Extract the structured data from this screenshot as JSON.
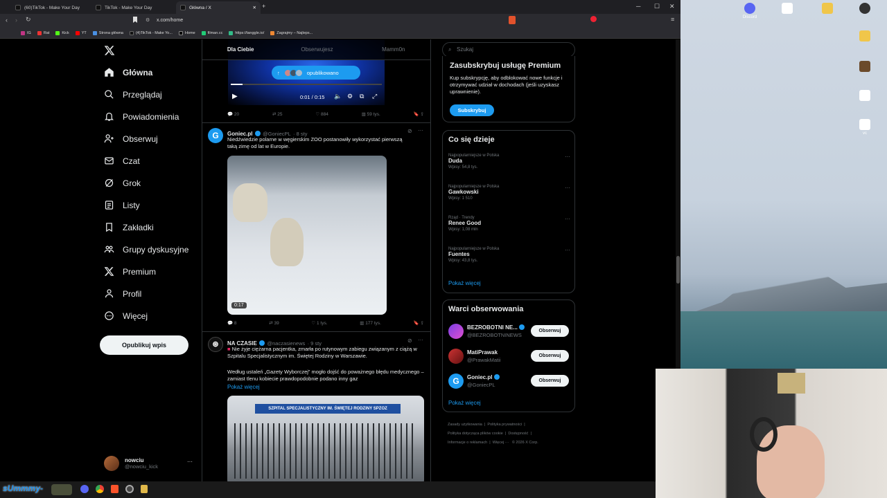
{
  "browser": {
    "tabs": [
      {
        "label": "(60)TikTok - Make Your Day"
      },
      {
        "label": "TikTok - Make Your Day"
      },
      {
        "label": "Główna / X"
      }
    ],
    "new_tab": "+",
    "url": "x.com/home",
    "bookmarks": [
      "IG",
      "Rat",
      "Kick",
      "YT",
      "Strona główna",
      "(4)TikTok - Make Yo...",
      "Home",
      "filman.cc",
      "https://tanggle.io/",
      "Zagrajmy – Najleps..."
    ]
  },
  "sidebar": {
    "items": [
      {
        "label": "Główna",
        "icon": "home-icon"
      },
      {
        "label": "Przeglądaj",
        "icon": "search-icon"
      },
      {
        "label": "Powiadomienia",
        "icon": "bell-icon"
      },
      {
        "label": "Obserwuj",
        "icon": "person-plus-icon"
      },
      {
        "label": "Czat",
        "icon": "mail-icon"
      },
      {
        "label": "Grok",
        "icon": "grok-icon"
      },
      {
        "label": "Listy",
        "icon": "list-icon"
      },
      {
        "label": "Zakładki",
        "icon": "bookmark-icon"
      },
      {
        "label": "Grupy dyskusyjne",
        "icon": "people-icon"
      },
      {
        "label": "Premium",
        "icon": "x-logo-icon"
      },
      {
        "label": "Profil",
        "icon": "person-icon"
      },
      {
        "label": "Więcej",
        "icon": "more-circle-icon"
      }
    ],
    "post_button": "Opublikuj wpis",
    "user": {
      "name": "nowciu",
      "handle": "@nowciu_kick",
      "more": "···"
    }
  },
  "feed": {
    "tabs": [
      "Dla Ciebie",
      "Obserwujesz",
      "Mamm0n"
    ],
    "top_post": {
      "pill": "opublikowano",
      "video_time": "0:01 / 0:15",
      "actions": {
        "replies": "20",
        "reposts": "25",
        "likes": "884",
        "views": "59 tys."
      }
    },
    "post1": {
      "name": "Goniec.pl",
      "handle": "@GoniecPL",
      "time": "· 8 sty",
      "text": "Niedźwiedzie polarne w węgierskim ZOO postanowiły wykorzystać pierwszą taką zimę od lat w Europie.",
      "duration": "0:17",
      "actions": {
        "replies": "8",
        "reposts": "39",
        "likes": "1 tys.",
        "views": "177 tys."
      }
    },
    "post2": {
      "name": "NA CZASIE",
      "handle": "@naczasienews",
      "time": "· 9 sty",
      "text1": "Nie żyje ciężarna pacjentka, zmarła po rutynowym zabiegu związanym z ciążą w Szpitalu Specjalistycznym im. Świętej Rodziny w Warszawie.",
      "text2": "Według ustaleń „Gazety Wyborczej” mogło dojść do poważnego błędu medycznego – zamiast tlenu kobiecie prawdopodobnie podano inny gaz",
      "show_more": "Pokaż więcej",
      "sign": "SZPITAL SPECJALISTYCZNY IM. ŚWIĘTEJ RODZINY SPZOZ"
    }
  },
  "right": {
    "search_placeholder": "Szukaj",
    "premium": {
      "title": "Zasubskrybuj usługę Premium",
      "text": "Kup subskrypcję, aby odblokować nowe funkcje i otrzymywać udział w dochodach (jeśli uzyskasz uprawnienie).",
      "button": "Subskrybuj"
    },
    "trends": {
      "title": "Co się dzieje",
      "items": [
        {
          "meta": "Najpopularniejsze w Polska",
          "name": "Duda",
          "count": "Wpisy: 54,8 tys."
        },
        {
          "meta": "Najpopularniejsze w Polska",
          "name": "Gawkowski",
          "count": "Wpisy: 1 510"
        },
        {
          "meta": "Rząd · Trendy",
          "name": "Renee Good",
          "count": "Wpisy: 1,08 mln"
        },
        {
          "meta": "Najpopularniejsze w Polska",
          "name": "Fuentes",
          "count": "Wpisy: 43,8 tys."
        }
      ],
      "show_more": "Pokaż więcej"
    },
    "who_to_follow": {
      "title": "Warci obserwowania",
      "accounts": [
        {
          "name": "BEZROBOTNI NE...",
          "handle": "@BEZROBOTNINEWS",
          "button": "Obserwuj"
        },
        {
          "name": "MatiPrawak",
          "handle": "@PrawakMatii",
          "button": "Obserwuj"
        },
        {
          "name": "Goniec.pl",
          "handle": "@GoniecPL",
          "button": "Obserwuj"
        }
      ],
      "show_more": "Pokaż więcej"
    },
    "footer": [
      "Zasady użytkowania",
      "Polityka prywatności",
      "Polityka dotycząca plików cookie",
      "Dostępność",
      "Informacje o reklamach",
      "Więcej ···",
      "© 2026 X Corp."
    ]
  },
  "taskbar": {
    "overlay_text": "sUmmmy-"
  },
  "desktop": {
    "icons": [
      "Discord",
      "vc"
    ]
  }
}
